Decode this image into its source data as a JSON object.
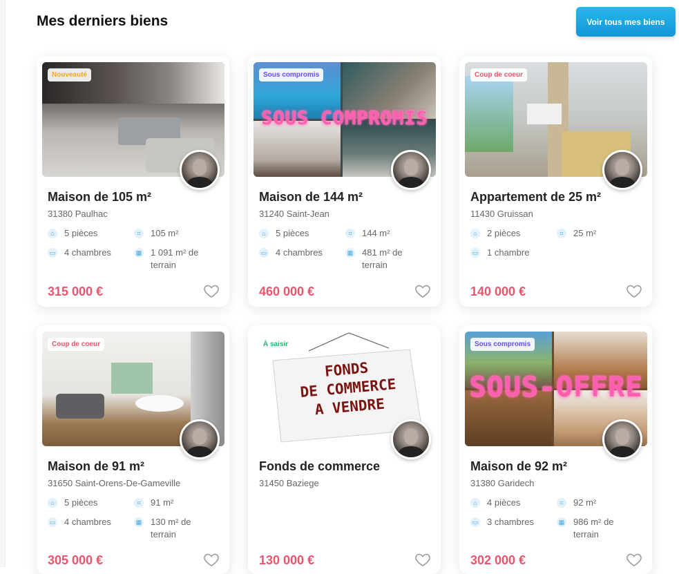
{
  "header": {
    "title": "Mes derniers biens",
    "see_all_label": "Voir tous mes biens"
  },
  "colors": {
    "accent": "#1596d8",
    "price": "#e8556d",
    "badge_new": "#f5a623",
    "badge_compromis": "#6a4cf3",
    "badge_coeur": "#e8556d",
    "badge_saisir": "#22b573"
  },
  "listings": [
    {
      "badge": "Nouveauté",
      "title": "Maison de 105 m²",
      "city": "31380 Paulhac",
      "rooms": "5 pièces",
      "area": "105 m²",
      "bedrooms": "4 chambres",
      "land": "1 091 m² de terrain",
      "price": "315 000 €"
    },
    {
      "badge": "Sous compromis",
      "overlay": "SOUS COMPROMIS",
      "title": "Maison de 144 m²",
      "city": "31240 Saint-Jean",
      "rooms": "5 pièces",
      "area": "144 m²",
      "bedrooms": "4 chambres",
      "land": "481 m² de terrain",
      "price": "460 000 €"
    },
    {
      "badge": "Coup de coeur",
      "title": "Appartement de 25 m²",
      "city": "11430 Gruissan",
      "rooms": "2 pièces",
      "area": "25 m²",
      "bedrooms": "1 chambre",
      "land": "",
      "price": "140 000 €"
    },
    {
      "badge": "Coup de coeur",
      "title": "Maison de 91 m²",
      "city": "31650 Saint-Orens-De-Gameville",
      "rooms": "5 pièces",
      "area": "91 m²",
      "bedrooms": "4 chambres",
      "land": "130 m² de terrain",
      "price": "305 000 €"
    },
    {
      "badge": "À saisir",
      "sign_lines": [
        "FONDS",
        "DE COMMERCE",
        "A VENDRE"
      ],
      "title": "Fonds de commerce",
      "city": "31450 Baziege",
      "price": "130 000 €"
    },
    {
      "badge": "Sous compromis",
      "overlay": "SOUS-OFFRE",
      "title": "Maison de 92 m²",
      "city": "31380 Garidech",
      "rooms": "4 pièces",
      "area": "92 m²",
      "bedrooms": "3 chambres",
      "land": "986 m² de terrain",
      "price": "302 000 €"
    }
  ]
}
